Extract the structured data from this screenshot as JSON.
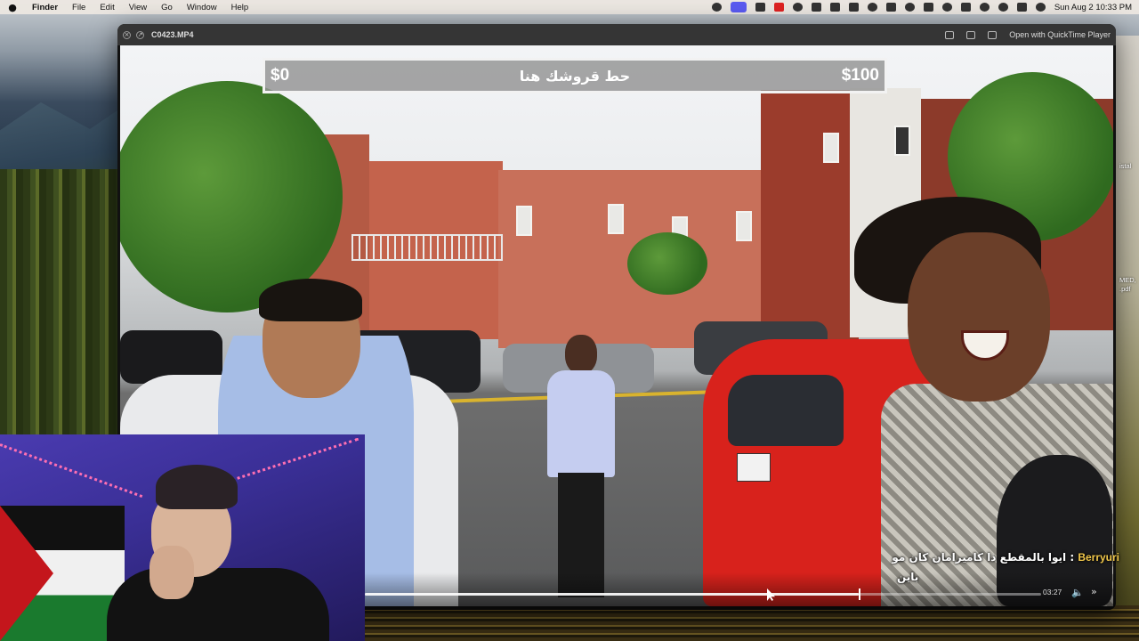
{
  "menubar": {
    "app_name": "Finder",
    "menus": [
      "File",
      "Edit",
      "View",
      "Go",
      "Window",
      "Help"
    ],
    "clock": "Sun Aug 2  10:33 PM"
  },
  "window": {
    "title": "C0423.MP4",
    "open_with": "Open with QuickTime Player"
  },
  "game_bar": {
    "min": "$0",
    "prompt": "حط قروشك هنا",
    "max": "$100"
  },
  "player": {
    "time": "03:27",
    "progress": 0.73
  },
  "chat": {
    "username": "Berryuri",
    "separator": " : ",
    "text_line1": "ايوا بالمقطع ذا كاميرامان كان مو",
    "text_line2": "باين"
  },
  "edge_text": [
    "istal",
    "MED,",
    ".pdf"
  ],
  "colors": {
    "menubar_bg": "#eee8e2",
    "chat_user": "#f2c84b",
    "game_bar_bg": "#969696"
  }
}
